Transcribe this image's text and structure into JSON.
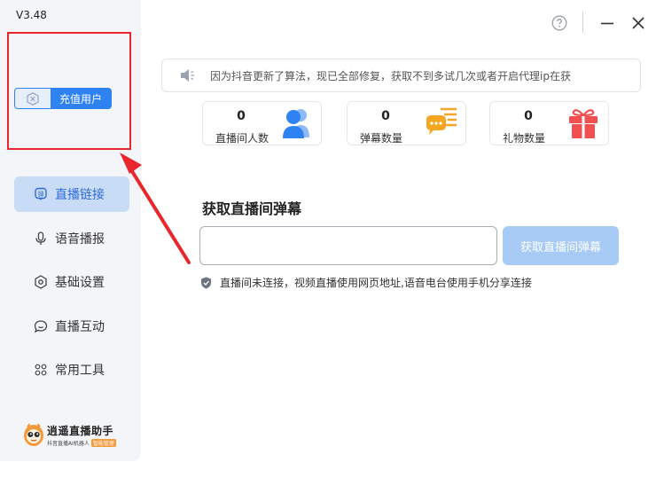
{
  "app": {
    "version": "V3.48"
  },
  "account": {
    "recharge_label": "充值用户"
  },
  "nav": {
    "items": [
      {
        "label": "直播链接",
        "icon": "live-link-icon",
        "active": true
      },
      {
        "label": "语音播报",
        "icon": "microphone-icon",
        "active": false
      },
      {
        "label": "基础设置",
        "icon": "settings-icon",
        "active": false
      },
      {
        "label": "直播互动",
        "icon": "chat-icon",
        "active": false
      },
      {
        "label": "常用工具",
        "icon": "grid-icon",
        "active": false
      }
    ]
  },
  "brand": {
    "name": "逍遥直播助手",
    "subtitle": "抖音直播AI机器人",
    "tag": "智能管理"
  },
  "titlebar": {
    "help_icon": "help-circle-icon",
    "minimize_icon": "minimize-icon",
    "close_icon": "close-icon"
  },
  "notice": {
    "icon": "speaker-icon",
    "text": "因为抖音更新了算法，现已全部修复，获取不到多试几次或者开启代理ip在获"
  },
  "stats": [
    {
      "value": "0",
      "label": "直播间人数",
      "icon": "users-icon",
      "color": "#2f82f2"
    },
    {
      "value": "0",
      "label": "弹幕数量",
      "icon": "danmaku-icon",
      "color": "#f5a623"
    },
    {
      "value": "0",
      "label": "礼物数量",
      "icon": "gift-icon",
      "color": "#f0504f"
    }
  ],
  "fetch": {
    "title": "获取直播间弹幕",
    "input_value": "",
    "button_label": "获取直播间弹幕",
    "hint": "直播间未连接，视频直播使用网页地址,语音电台使用手机分享连接"
  },
  "colors": {
    "accent": "#2f82f2",
    "annotation": "#e8262b",
    "button_disabled": "#a8cbf6"
  }
}
